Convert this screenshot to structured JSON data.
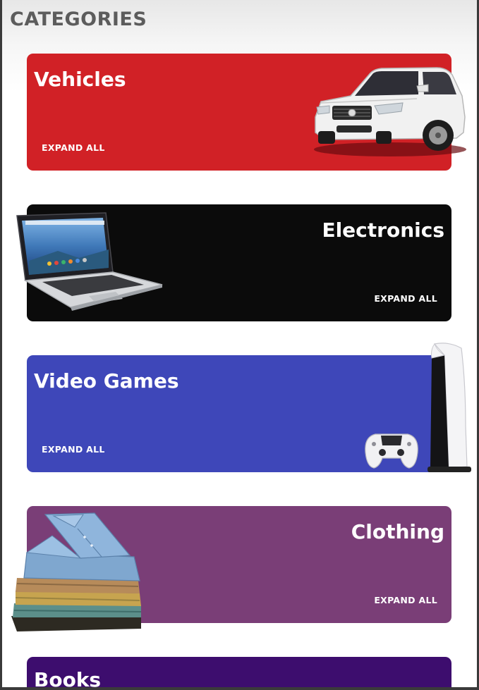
{
  "page": {
    "title": "CATEGORIES"
  },
  "categories": [
    {
      "name": "Vehicles",
      "action": "EXPAND ALL",
      "color": "#d12126",
      "icon": "car-image"
    },
    {
      "name": "Electronics",
      "action": "EXPAND ALL",
      "color": "#0b0b0b",
      "icon": "laptop-image"
    },
    {
      "name": "Video Games",
      "action": "EXPAND ALL",
      "color": "#3e47b9",
      "icon": "game-console-image"
    },
    {
      "name": "Clothing",
      "action": "EXPAND ALL",
      "color": "#7a3e77",
      "icon": "shirt-stack-image"
    },
    {
      "name": "Books",
      "action": "",
      "color": "#3d0d6e",
      "icon": ""
    }
  ]
}
